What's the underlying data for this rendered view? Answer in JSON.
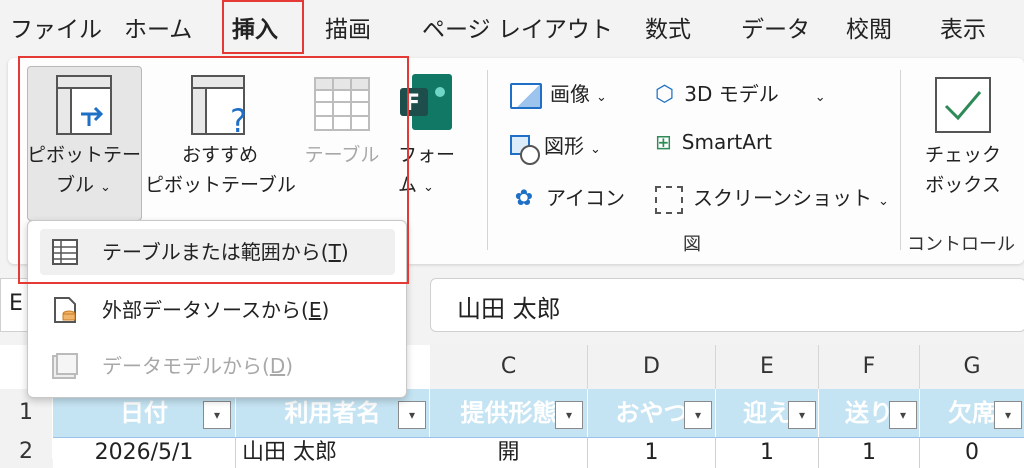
{
  "tabs": [
    "ファイル",
    "ホーム",
    "挿入",
    "描画",
    "ページ レイアウト",
    "数式",
    "データ",
    "校閲",
    "表示"
  ],
  "ribbon": {
    "pivot_line1": "ピボットテー",
    "pivot_line2": "ブル",
    "recommended_line1": "おすすめ",
    "recommended_line2": "ピボットテーブル",
    "table": "テーブル",
    "forms_line1": "フォー",
    "forms_line2": "ム",
    "image": "画像",
    "shapes": "図形",
    "icons": "アイコン",
    "model3d": "3D モデル",
    "smartart": "SmartArt",
    "screenshot": "スクリーンショット",
    "group_illustrations": "図",
    "checkbox_line1": "チェック",
    "checkbox_line2": "ボックス",
    "group_controls": "コントロール"
  },
  "dropdown": {
    "item1": "テーブルまたは範囲から(",
    "item1_key": "T",
    "item2": "外部データソースから(",
    "item2_key": "E",
    "item3": "データモデルから(",
    "item3_key": "D",
    "close": ")"
  },
  "formula": {
    "value": "山田 太郎",
    "namebox": "E"
  },
  "sheet": {
    "columns": [
      "C",
      "D",
      "E",
      "F",
      "G"
    ],
    "rows": [
      "1",
      "2"
    ],
    "headers": [
      "日付",
      "利用者名",
      "提供形態",
      "おやつ",
      "迎え",
      "送り",
      "欠席"
    ],
    "row2": [
      "2026/5/1",
      "山田 太郎",
      "開",
      "1",
      "1",
      "1",
      "0"
    ]
  },
  "colors": {
    "accent_red": "#e53935",
    "table_header": "#c5e4f3"
  }
}
